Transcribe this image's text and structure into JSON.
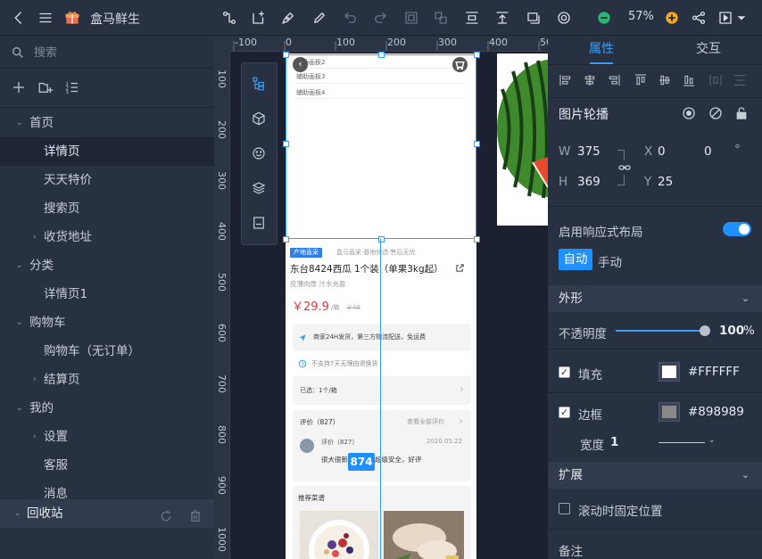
{
  "app": {
    "project_title": "盒马鲜生",
    "zoom": "57%",
    "colors": {
      "accent": "#3d9df3",
      "toolbar_bg": "#283141",
      "minus": "#2bb673",
      "plus": "#f5a623"
    }
  },
  "sidebar": {
    "search_placeholder": "搜索",
    "tree": [
      {
        "label": "首页",
        "level": 0,
        "expanded": true
      },
      {
        "label": "详情页",
        "level": 1,
        "active": true
      },
      {
        "label": "天天特价",
        "level": 1
      },
      {
        "label": "搜索页",
        "level": 1
      },
      {
        "label": "收货地址",
        "level": 1,
        "collapsed": true
      },
      {
        "label": "分类",
        "level": 0,
        "expanded": true
      },
      {
        "label": "详情页1",
        "level": 1
      },
      {
        "label": "购物车",
        "level": 0,
        "expanded": true
      },
      {
        "label": "购物车（无订单）",
        "level": 1
      },
      {
        "label": "结算页",
        "level": 1,
        "collapsed": true
      },
      {
        "label": "我的",
        "level": 0,
        "expanded": true
      },
      {
        "label": "设置",
        "level": 1,
        "collapsed": true
      },
      {
        "label": "客服",
        "level": 1
      },
      {
        "label": "消息",
        "level": 1
      }
    ],
    "recycle_label": "回收站"
  },
  "canvas": {
    "ruler_h": [
      "-100",
      "0",
      "100",
      "200",
      "300",
      "400",
      "500"
    ],
    "ruler_v": [
      "100",
      "200",
      "300",
      "400",
      "500",
      "600",
      "700",
      "800",
      "900",
      "1000"
    ],
    "width_badge": "874",
    "phone": {
      "panels": [
        "辅助画板2",
        "辅助画板3",
        "辅助画板4"
      ],
      "tag": "产地直采",
      "tag_sub": "盒马直采·基地优选·售后无忧",
      "product_title": "东台8424西瓜 1个装（单果3kg起）",
      "product_sub": "皮薄肉厚 汁水充盈",
      "price": "￥29.9",
      "price_unit": "/箱",
      "price_old": "￥46",
      "delivery": "商家24H发货，第三方物流配送，免运费",
      "no_return": "不支持7天无理由退换货",
      "selected": "已选：1个/箱",
      "review_title": "评价（827）",
      "review_all": "查看全部评价",
      "reviewer": "评价（827）",
      "review_date": "2020.05.22",
      "review_text": "很大很新鲜，物流超级安全，好评",
      "recommend": "推荐菜谱"
    }
  },
  "props": {
    "tab_props": "属性",
    "tab_interact": "交互",
    "component_name": "图片轮播",
    "w_label": "W",
    "w_value": "375",
    "h_label": "H",
    "h_value": "369",
    "x_label": "X",
    "x_value": "0",
    "y_label": "Y",
    "y_value": "25",
    "rot_value": "0",
    "rot_unit": "°",
    "responsive_label": "启用响应式布局",
    "auto_label": "自动",
    "manual_label": "手动",
    "appearance_title": "外形",
    "opacity_label": "不透明度",
    "opacity_value": "100",
    "opacity_unit": "%",
    "opacity_level": 1.0,
    "fill_label": "填充",
    "fill_color": "#FFFFFF",
    "border_label": "边框",
    "border_color": "#898989",
    "width_label": "宽度",
    "width_value": "1",
    "extend_title": "扩展",
    "fixed_label": "滚动时固定位置",
    "note_label": "备注"
  }
}
